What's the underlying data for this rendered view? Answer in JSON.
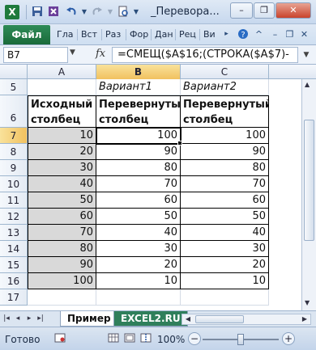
{
  "window": {
    "title": "_Перевора...",
    "minimize": "–",
    "restore": "❐",
    "close": "✕"
  },
  "quick_access": {
    "app_icon": "X",
    "save_icon": "floppy-icon",
    "undo_icon": "undo-icon",
    "redo_icon": "redo-icon",
    "preview_icon": "print-preview-icon"
  },
  "ribbon": {
    "file_tab": "Файл",
    "tabs": [
      "Гла",
      "Вст",
      "Раз",
      "Фор",
      "Дан",
      "Рец",
      "Ви"
    ]
  },
  "formula_bar": {
    "name_box": "B7",
    "fx_label": "fx",
    "formula": "=СМЕЩ($A$16;(СТРОКА($A$7)-"
  },
  "grid": {
    "columns": [
      "A",
      "B",
      "C"
    ],
    "rows": [
      {
        "num": "5",
        "a": "",
        "b": "Вариант1",
        "c": "Вариант2"
      },
      {
        "num": "6",
        "a": "Исходный столбец",
        "b": "Перевернутый столбец",
        "c": "Перевернутый столбец"
      },
      {
        "num": "7",
        "a": "10",
        "b": "100",
        "c": "100"
      },
      {
        "num": "8",
        "a": "20",
        "b": "90",
        "c": "90"
      },
      {
        "num": "9",
        "a": "30",
        "b": "80",
        "c": "80"
      },
      {
        "num": "10",
        "a": "40",
        "b": "70",
        "c": "70"
      },
      {
        "num": "11",
        "a": "50",
        "b": "60",
        "c": "60"
      },
      {
        "num": "12",
        "a": "60",
        "b": "50",
        "c": "50"
      },
      {
        "num": "13",
        "a": "70",
        "b": "40",
        "c": "40"
      },
      {
        "num": "14",
        "a": "80",
        "b": "30",
        "c": "30"
      },
      {
        "num": "15",
        "a": "90",
        "b": "20",
        "c": "20"
      },
      {
        "num": "16",
        "a": "100",
        "b": "10",
        "c": "10"
      },
      {
        "num": "17",
        "a": "",
        "b": "",
        "c": ""
      }
    ]
  },
  "sheets": {
    "active": "Пример",
    "other": "EXCEL2.RU"
  },
  "status": {
    "ready": "Готово",
    "zoom": "100%",
    "zoom_minus": "−",
    "zoom_plus": "+",
    "zoom_fraction": 0.5
  }
}
